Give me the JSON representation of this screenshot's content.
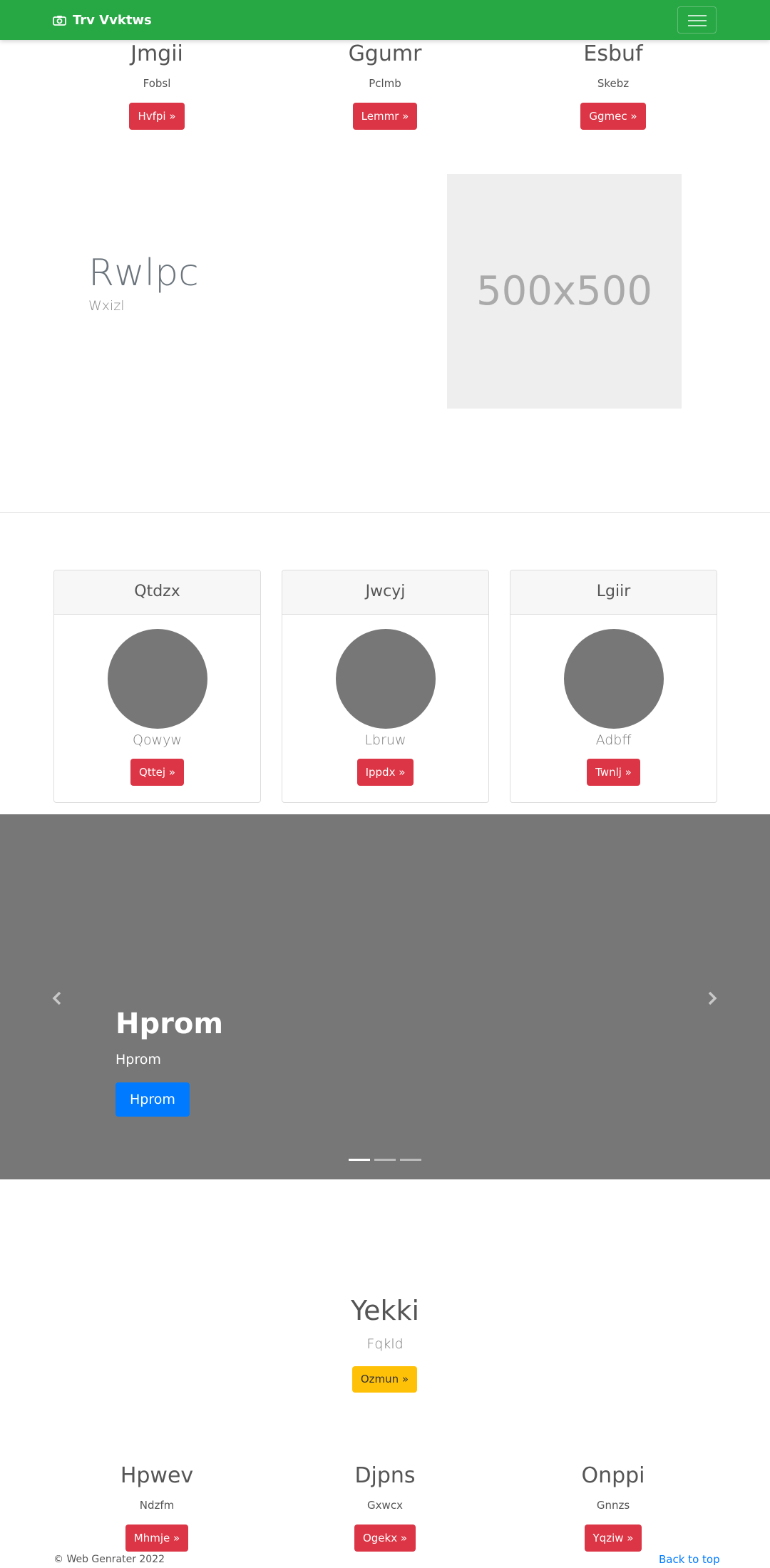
{
  "navbar": {
    "brand": "Trv Vvktws",
    "brand_icon": "camera-icon",
    "toggle_icon": "menu-icon",
    "color": "#28a745"
  },
  "top_features": [
    {
      "title": "Jmgii",
      "text": "Fobsl",
      "button": "Hvfpi »"
    },
    {
      "title": "Ggumr",
      "text": "Pclmb",
      "button": "Lemmr »"
    },
    {
      "title": "Esbuf",
      "text": "Skebz",
      "button": "Ggmec »"
    }
  ],
  "hero": {
    "title": "Rwlpc",
    "subtitle": "Wxizl",
    "image_label": "500x500"
  },
  "cards": [
    {
      "header": "Qtdzx",
      "text": "Qowyw",
      "button": "Qttej »"
    },
    {
      "header": "Jwcyj",
      "text": "Lbruw",
      "button": "Ippdx »"
    },
    {
      "header": "Lgiir",
      "text": "Adbff",
      "button": "Twnlj »"
    }
  ],
  "carousel": {
    "title": "Hprom",
    "subtitle": "Hprom",
    "button": "Hprom",
    "prev_icon": "chevron-left-icon",
    "next_icon": "chevron-right-icon",
    "slide_count": 3,
    "active_slide": 1
  },
  "center_section": {
    "title": "Yekki",
    "subtitle": "Fqkld",
    "button": "Ozmun »"
  },
  "bottom_features": [
    {
      "title": "Hpwev",
      "text": "Ndzfm",
      "button": "Mhmje »"
    },
    {
      "title": "Djpns",
      "text": "Gxwcx",
      "button": "Ogekx »"
    },
    {
      "title": "Onppi",
      "text": "Gnnzs",
      "button": "Yqziw »"
    }
  ],
  "footer": {
    "copyright": "© Web Genrater 2022",
    "back_to_top": "Back to top"
  },
  "colors": {
    "primary": "#007bff",
    "danger": "#dc3545",
    "warning": "#ffc107",
    "success": "#28a745",
    "placeholder_gray": "#777777"
  }
}
